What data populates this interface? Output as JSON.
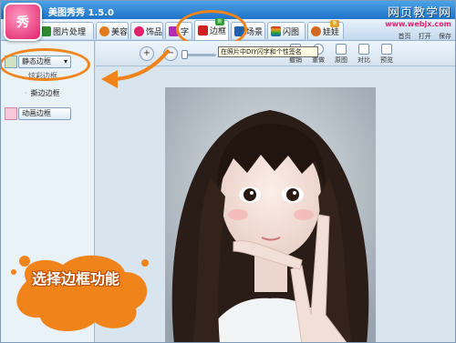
{
  "app": {
    "logo_text": "秀",
    "title": "美图秀秀 1.5.0",
    "watermark_title": "网页教学网",
    "watermark_sub": "www.webjx.com",
    "top_link_1": "首页",
    "top_link_2": "打开",
    "top_link_3": "保存"
  },
  "tabs": [
    {
      "label": "图片处理",
      "color": "#2f8a2f"
    },
    {
      "label": "美容",
      "color": "#e07a1a"
    },
    {
      "label": "饰品",
      "color": "#e0206b"
    },
    {
      "label": "字",
      "color": "#b02fb0"
    },
    {
      "label": "边框",
      "color": "#d02020",
      "badge": "新"
    },
    {
      "label": "场景",
      "color": "#2060b0"
    },
    {
      "label": "闪图",
      "color": "#c0a020"
    },
    {
      "label": "娃娃",
      "color": "#d06a20",
      "badge": "新"
    }
  ],
  "left_panel": {
    "static_frame_button": "静态边框",
    "static_frame_sub": "炫彩边框",
    "tear_frame": "撕边边框",
    "animated_frame_button": "动画边框"
  },
  "toolbar": {
    "undo": "撤销",
    "redo": "重做",
    "original": "原图",
    "compare": "对比",
    "preview": "预览"
  },
  "hint": "在照片中DIY闪字和个性签名",
  "callout": "选择边框功能",
  "colors": {
    "accent": "#f0841a",
    "titlebar": "#1f73c9"
  }
}
